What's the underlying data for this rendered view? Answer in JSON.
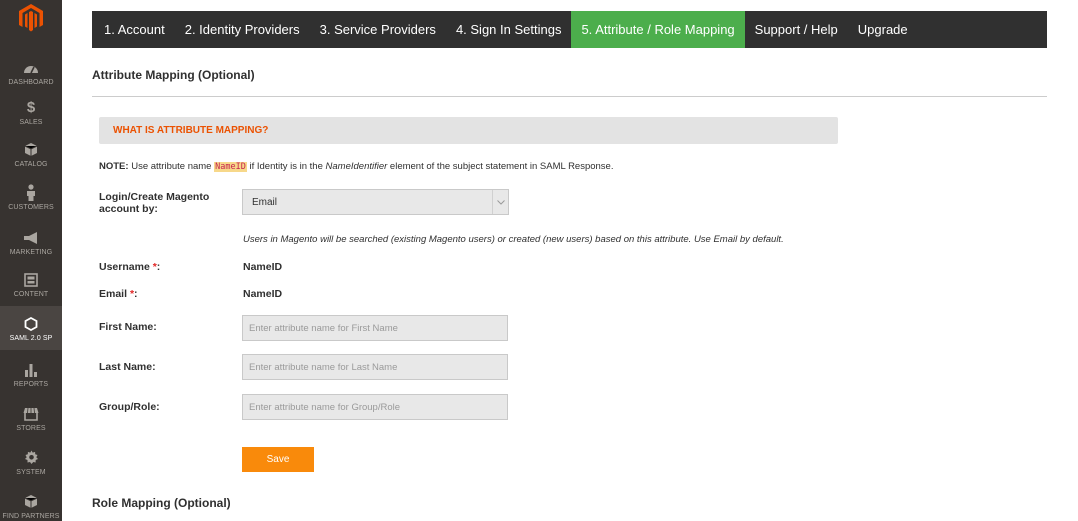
{
  "sidebar": {
    "logo": "magento-logo",
    "items": [
      {
        "label": "DASHBOARD",
        "icon": "dashboard-icon"
      },
      {
        "label": "SALES",
        "icon": "dollar-icon"
      },
      {
        "label": "CATALOG",
        "icon": "cube-icon"
      },
      {
        "label": "CUSTOMERS",
        "icon": "person-icon"
      },
      {
        "label": "MARKETING",
        "icon": "megaphone-icon"
      },
      {
        "label": "CONTENT",
        "icon": "content-icon"
      },
      {
        "label": "SAML 2.0 SP",
        "icon": "saml-icon"
      },
      {
        "label": "REPORTS",
        "icon": "bar-chart-icon"
      },
      {
        "label": "STORES",
        "icon": "store-icon"
      },
      {
        "label": "SYSTEM",
        "icon": "gear-icon"
      },
      {
        "label": "FIND PARTNERS",
        "icon": "cube-icon"
      }
    ]
  },
  "tabs": [
    {
      "label": "1. Account"
    },
    {
      "label": "2. Identity Providers"
    },
    {
      "label": "3. Service Providers"
    },
    {
      "label": "4. Sign In Settings"
    },
    {
      "label": "5. Attribute / Role Mapping",
      "active": true
    },
    {
      "label": "Support / Help"
    },
    {
      "label": "Upgrade"
    }
  ],
  "attribute_section": {
    "title": "Attribute Mapping (Optional)",
    "info_bar": "WHAT IS ATTRIBUTE MAPPING?",
    "note_prefix": "NOTE:",
    "note_text1": " Use attribute name ",
    "note_code": "NameID",
    "note_text2": " if Identity is in the ",
    "note_italic": "NameIdentifier",
    "note_text3": " element of the subject statement in SAML Response."
  },
  "form": {
    "login_label": "Login/Create Magento account by:",
    "login_value": "Email",
    "login_hint": "Users in Magento will be searched (existing Magento users) or created (new users) based on this attribute. Use Email by default.",
    "username_label": "Username",
    "username_value": "NameID",
    "email_label": "Email",
    "email_value": "NameID",
    "required_mark": "*",
    "colon": ":",
    "first_name_label": "First Name:",
    "first_name_placeholder": "Enter attribute name for First Name",
    "last_name_label": "Last Name:",
    "last_name_placeholder": "Enter attribute name for Last Name",
    "group_label": "Group/Role:",
    "group_placeholder": "Enter attribute name for Group/Role",
    "save_label": "Save"
  },
  "role_section": {
    "title": "Role Mapping (Optional)"
  },
  "colors": {
    "sidebar_bg": "#373330",
    "tabs_bg": "#303030",
    "active_tab": "#4cae4c",
    "accent_orange": "#eb5202",
    "save_button": "#f98a0b",
    "required": "#e22626"
  }
}
